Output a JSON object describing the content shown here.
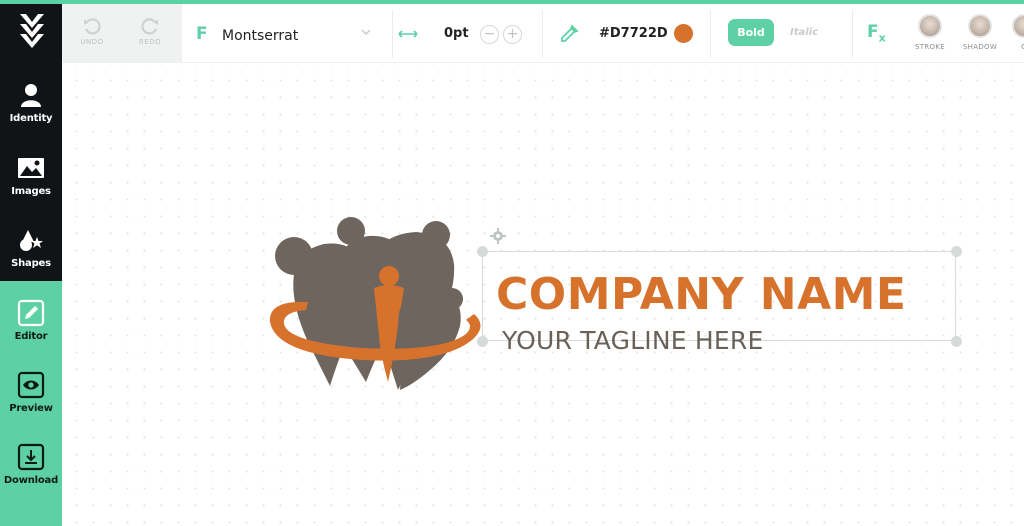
{
  "sidebar": {
    "brand_icon": "w-logo-icon",
    "items": [
      {
        "label": "Identity",
        "icon": "person-icon"
      },
      {
        "label": "Images",
        "icon": "image-icon"
      },
      {
        "label": "Shapes",
        "icon": "shapes-icon"
      },
      {
        "label": "Editor",
        "icon": "editor-icon"
      },
      {
        "label": "Preview",
        "icon": "eye-icon"
      },
      {
        "label": "Download",
        "icon": "download-icon"
      }
    ]
  },
  "toolbar": {
    "undo_label": "UNDO",
    "redo_label": "REDO",
    "font_icon_letter": "F",
    "font_name": "Montserrat",
    "letter_spacing": "0pt",
    "minus_label": "−",
    "plus_label": "+",
    "color_hex": "#D7722D",
    "bold_label": "Bold",
    "italic_label": "Italic",
    "fx_label": "F",
    "fx_sub": "x",
    "effects": [
      "STROKE",
      "SHADOW",
      "G"
    ]
  },
  "canvas": {
    "company_name": "COMPANY NAME",
    "tagline": "YOUR TAGLINE HERE"
  },
  "colors": {
    "accent": "#5ED0A6",
    "sidebar_dark": "#111416",
    "logo_orange": "#D7722D",
    "logo_gray": "#6E665E"
  }
}
